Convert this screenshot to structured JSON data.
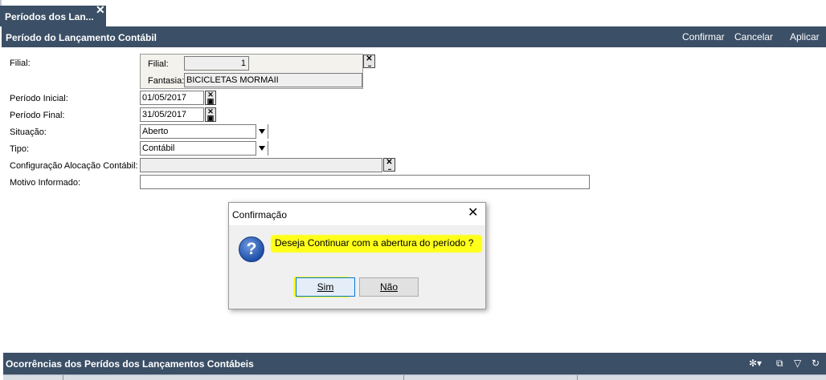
{
  "tab": {
    "label": "Períodos dos Lan...",
    "close": "✕"
  },
  "header": {
    "title": "Período do Lançamento Contábil",
    "confirm": "Confirmar",
    "cancel": "Cancelar",
    "apply": "Aplicar"
  },
  "form": {
    "filial_label": "Filial:",
    "filial_inner_label": "Filial:",
    "filial_value": "1",
    "fantasia_label": "Fantasia:",
    "fantasia_value": "BICICLETAS MORMAII",
    "periodo_inicial_label": "Período Inicial:",
    "periodo_inicial_value": "01/05/2017",
    "periodo_final_label": "Período Final:",
    "periodo_final_value": "31/05/2017",
    "situacao_label": "Situação:",
    "situacao_value": "Aberto",
    "tipo_label": "Tipo:",
    "tipo_value": "Contábil",
    "config_label": "Configuração Alocação Contábil:",
    "config_value": "",
    "motivo_label": "Motivo Informado:",
    "motivo_value": ""
  },
  "dialog": {
    "title": "Confirmação",
    "icon": "question-icon",
    "icon_glyph": "?",
    "message": "Deseja Continuar com a abertura do período ?",
    "yes": "Sim",
    "no": "Não",
    "close": "✕",
    "highlight_color": "#ffff1a"
  },
  "occurrences": {
    "title": "Ocorrências dos Perídos dos Lançamentos Contábeis"
  },
  "colors": {
    "header_bg": "#3b4f66",
    "highlight": "#ffff1a"
  }
}
